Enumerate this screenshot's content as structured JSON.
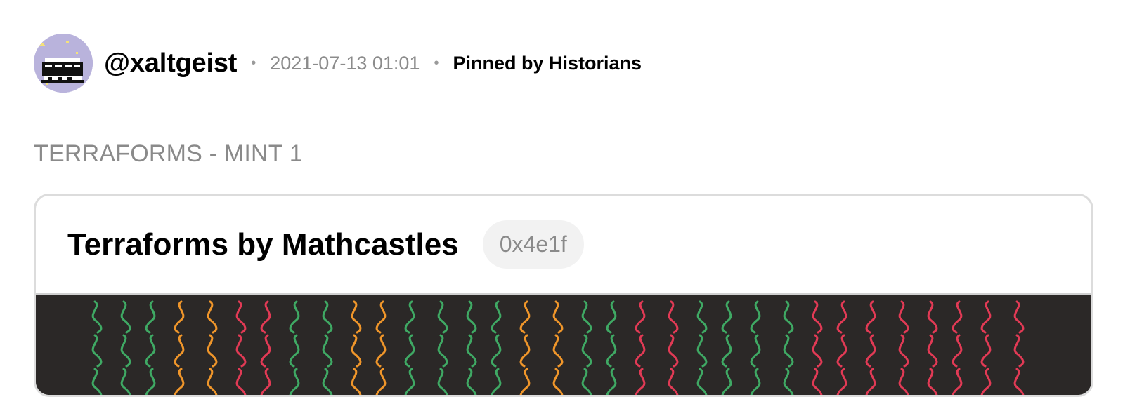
{
  "post": {
    "username": "@xaltgeist",
    "timestamp": "2021-07-13 01:01",
    "separator": "•",
    "pinned_label": "Pinned by Historians",
    "title": "TERRAFORMS - MINT 1"
  },
  "card": {
    "collection_name": "Terraforms by Mathcastles",
    "contract_short": "0x4e1f"
  },
  "colors": {
    "artwork_background": "#2b2827",
    "stroke_green": "#3fa964",
    "stroke_orange": "#f0962a",
    "stroke_red": "#e23a55"
  }
}
